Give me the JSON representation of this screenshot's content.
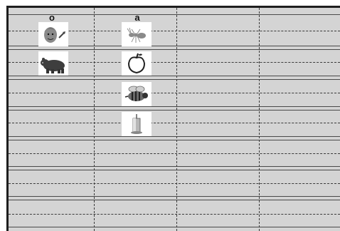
{
  "worksheet": {
    "columns": [
      {
        "letter": "o",
        "pictures": [
          {
            "icon": "boy-face-icon",
            "row": 0
          },
          {
            "icon": "bear-icon",
            "row": 1
          }
        ]
      },
      {
        "letter": "a",
        "pictures": [
          {
            "icon": "ant-icon",
            "row": 0
          },
          {
            "icon": "apple-icon",
            "row": 1
          },
          {
            "icon": "bee-icon",
            "row": 2
          },
          {
            "icon": "candle-icon",
            "row": 3
          }
        ]
      },
      {
        "letter": "",
        "pictures": []
      },
      {
        "letter": "",
        "pictures": []
      }
    ],
    "row_count": 7,
    "colors": {
      "paper": "#d4d4d4",
      "frame": "#1e1e1e",
      "rule": "#4a4a4a"
    }
  }
}
